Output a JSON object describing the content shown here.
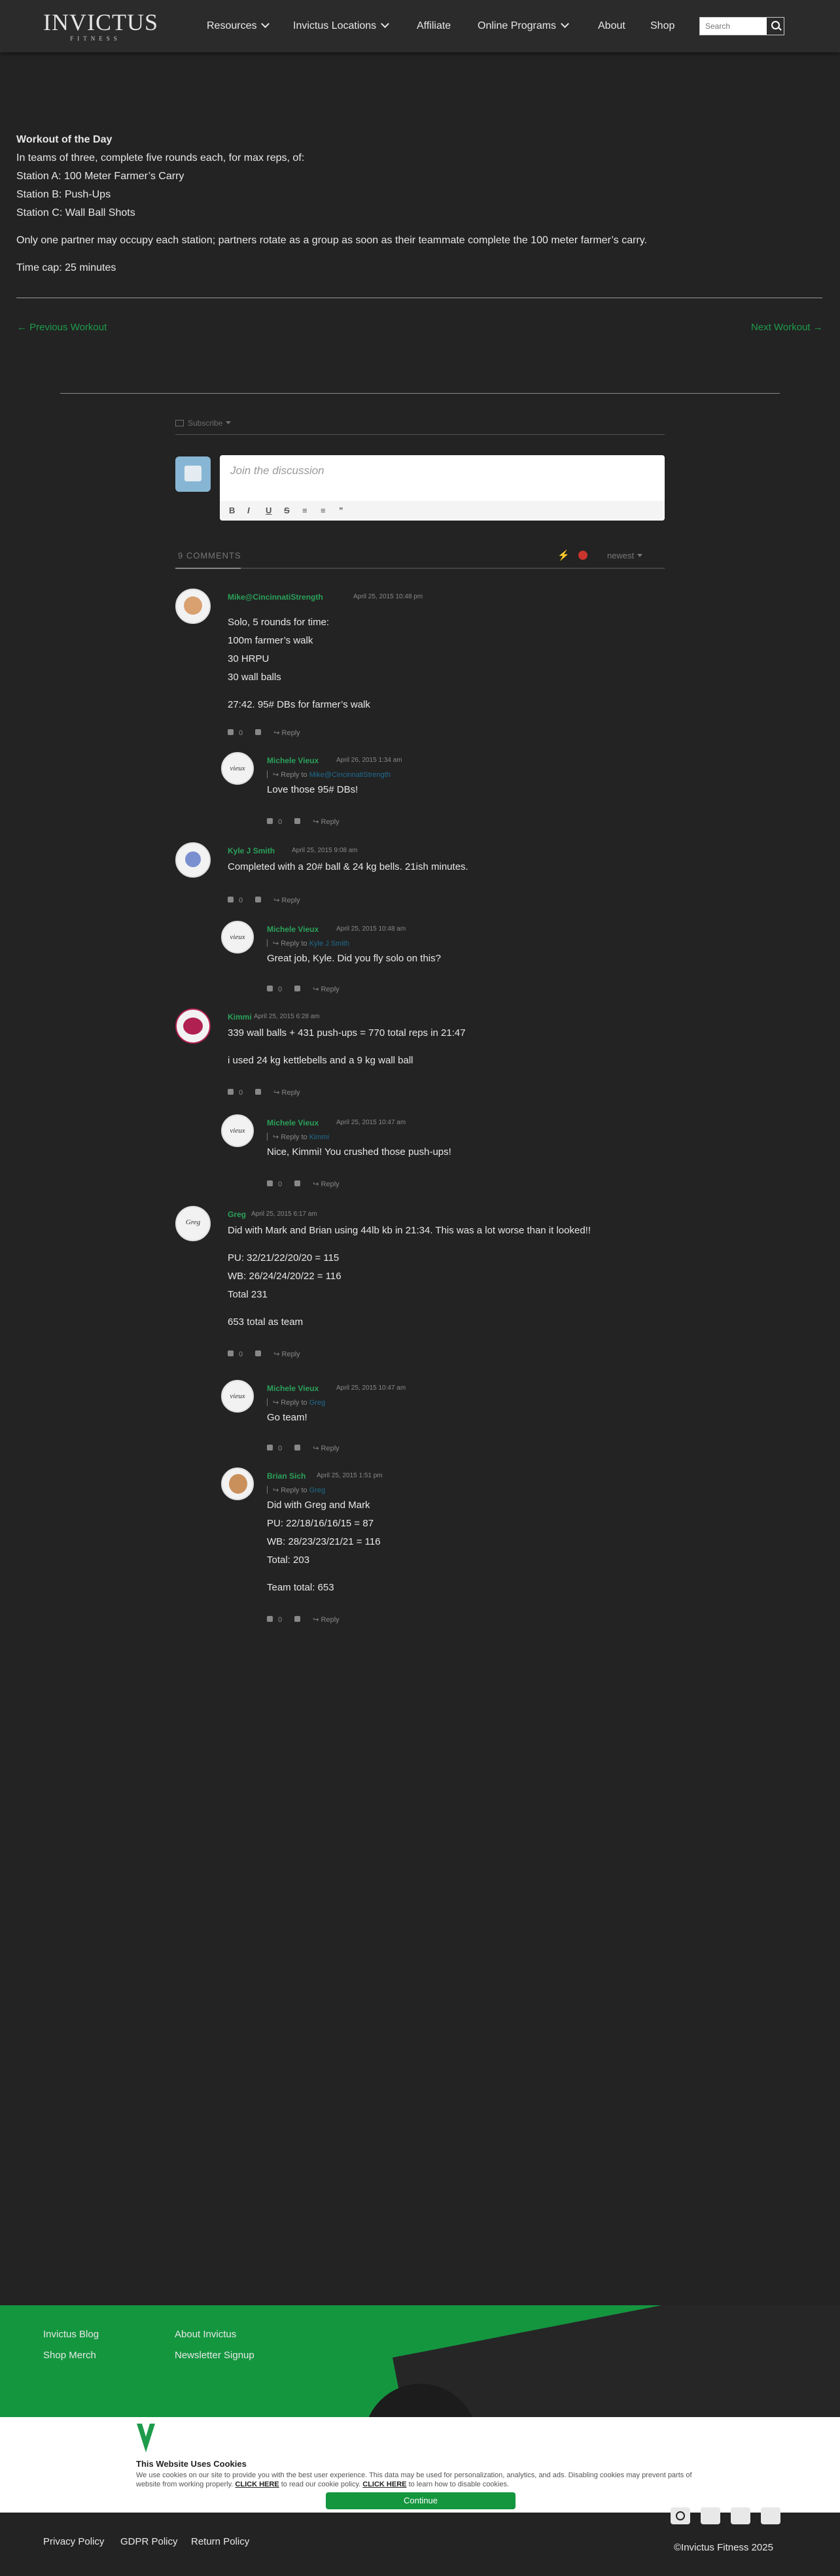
{
  "header": {
    "logo_text": "INVICTUS",
    "logo_sub": "FITNESS",
    "menu": [
      {
        "label": "Resources",
        "dropdown": true
      },
      {
        "label": "Invictus Locations",
        "dropdown": true
      },
      {
        "label": "Affiliate",
        "dropdown": false
      },
      {
        "label": "Online Programs",
        "dropdown": true
      },
      {
        "label": "About",
        "dropdown": false
      },
      {
        "label": "Shop",
        "dropdown": false
      }
    ],
    "search_placeholder": "Search"
  },
  "workout": {
    "title": "Workout of the Day",
    "line1": "In teams of three, complete five rounds each, for max reps, of:",
    "station_a": "Station A: 100 Meter Farmer’s Carry",
    "station_b": "Station B: Push-Ups",
    "station_c": "Station C: Wall Ball Shots",
    "note": "Only one partner may occupy each station; partners rotate as a group as soon as their teammate complete the 100 meter farmer’s carry.",
    "timecap": "Time cap: 25 minutes"
  },
  "nav": {
    "prev": "← Previous Workout",
    "next": "Next Workout →"
  },
  "discussion": {
    "subscribe": "Subscribe",
    "placeholder": "Join the discussion",
    "toolbar": [
      "B",
      "I",
      "U",
      "S",
      "≡",
      "≡",
      "”"
    ],
    "count": "9 COMMENTS",
    "sort": "newest"
  },
  "comments": [
    {
      "author": "Mike@CincinnatiStrength",
      "date": "April 25, 2015 10:48 pm",
      "reply_to": "",
      "lines": [
        "Solo, 5 rounds for time:",
        "100m farmer’s walk",
        "30 HRPU",
        "30 wall balls",
        "",
        "27:42. 95# DBs for farmer’s walk"
      ],
      "votes": "0",
      "reply": "Reply"
    },
    {
      "author": "Michele Vieux",
      "date": "April 26, 2015 1:34 am",
      "reply_to": "Mike@CincinnatiStrength",
      "lines": [
        "Love those 95# DBs!"
      ],
      "votes": "0",
      "reply": "Reply"
    },
    {
      "author": "Kyle J Smith",
      "date": "April 25, 2015 9:08 am",
      "reply_to": "",
      "lines": [
        "Completed with a 20# ball & 24 kg bells. 21ish minutes."
      ],
      "votes": "0",
      "reply": "Reply"
    },
    {
      "author": "Michele Vieux",
      "date": "April 25, 2015 10:48 am",
      "reply_to": "Kyle J Smith",
      "lines": [
        "Great job, Kyle. Did you fly solo on this?"
      ],
      "votes": "0",
      "reply": "Reply"
    },
    {
      "author": "Kimmi",
      "date": "April 25, 2015 6:28 am",
      "reply_to": "",
      "lines": [
        "339 wall balls + 431 push-ups = 770 total reps in 21:47",
        "",
        "i used 24 kg kettlebells and a 9 kg wall ball"
      ],
      "votes": "0",
      "reply": "Reply"
    },
    {
      "author": "Michele Vieux",
      "date": "April 25, 2015 10:47 am",
      "reply_to": "Kimmi",
      "lines": [
        "Nice, Kimmi! You crushed those push-ups!"
      ],
      "votes": "0",
      "reply": "Reply"
    },
    {
      "author": "Greg",
      "date": "April 25, 2015 6:17 am",
      "reply_to": "",
      "lines": [
        "Did with Mark and Brian using 44lb kb in 21:34. This was a lot worse than it looked!!",
        "",
        "PU: 32/21/22/20/20 = 115",
        "WB: 26/24/24/20/22 = 116",
        "Total 231",
        "",
        "653 total as team"
      ],
      "votes": "0",
      "reply": "Reply"
    },
    {
      "author": "Michele Vieux",
      "date": "April 25, 2015 10:47 am",
      "reply_to": "Greg",
      "lines": [
        "Go team!"
      ],
      "votes": "0",
      "reply": "Reply"
    },
    {
      "author": "Brian Sich",
      "date": "April 25, 2015 1:51 pm",
      "reply_to": "Greg",
      "lines": [
        "Did with Greg and Mark",
        "PU: 22/18/16/16/15 = 87",
        "WB: 28/23/23/21/21 = 116",
        "Total: 203",
        "",
        "Team total: 653"
      ],
      "votes": "0",
      "reply": "Reply"
    }
  ],
  "footer": {
    "links_col1": [
      "Invictus Blog",
      "Shop Merch"
    ],
    "links_col2": [
      "About Invictus",
      "Newsletter Signup"
    ],
    "legal": [
      "Privacy Policy",
      "GDPR Policy",
      "Return Policy"
    ],
    "copyright": "©Invictus Fitness 2025"
  },
  "cookie": {
    "title": "This Website Uses Cookies",
    "text_1": "We use cookies on our site to provide you with the best user experience. This data may be used for personalization, analytics, and ads. Disabling cookies may prevent parts of website from working properly.",
    "link_1": "CLICK HERE",
    "text_2": "to read our cookie policy.",
    "link_2": "CLICK HERE",
    "text_3": "to learn how to disable cookies.",
    "button": "Continue"
  },
  "colors": {
    "accent": "#14963f",
    "link": "#2aa15a",
    "background": "#232323"
  }
}
